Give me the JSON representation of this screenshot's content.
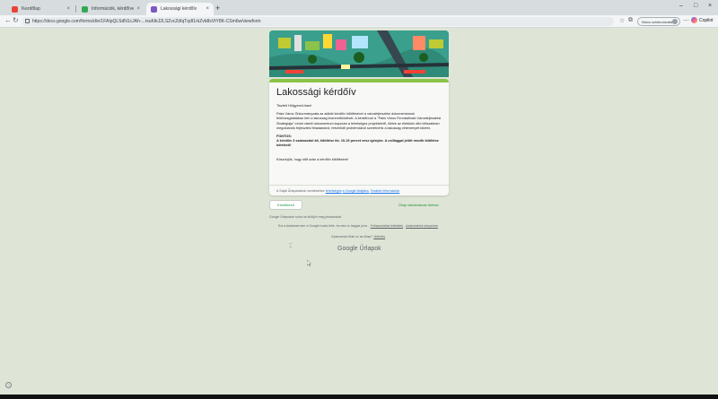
{
  "browser": {
    "tabs": [
      {
        "label": "Kezdőlap"
      },
      {
        "label": "Információk, kérdőívek leírásai"
      },
      {
        "label": "Lakossági kérdőív"
      }
    ],
    "address": "https://docs.google.com/forms/d/e/1FAIpQLSdN1cJAh-...rsuKtkJ2LSZvcZdIqTqdI1rkZvb8sVtY8K-CSm6w/viewform",
    "sync_label": "Nincs szinkronizálás",
    "copilot_label": "Copilot",
    "new_tab": "+"
  },
  "form": {
    "title": "Lakossági kérdőív",
    "greeting": "Tisztelt Hölgyem/Uram!",
    "intro": "Paks Város Önkormányzata az alábbi kérdőív kitöltésével a városfejlesztési dokumentumok felülvizsgálatában kéri a lakosság közreműködését. A kérdőívvel a \"Paks Város Fenntartható Városfejlesztési Stratégiája\" címet viselő dokumentum kapcsán a lehetséges projektekről, illetve az életükön álló időszakban megoldandó fejlesztési feladatokról, felvetődő problémákról szeretnénk a lakosság véleményét kikérni.",
    "important_label": "FONTOS:",
    "important_text": "A kérdőív 3 szakaszból áll, kitöltése kb. 10-15 percet vesz igénybe. A csillaggal jelölt mezők kitöltése kötelező!",
    "thanks": "Köszönjük, hogy időt szán a kérdőív kitöltésére!",
    "note_prefix": "A Saját Űrlapadatok mentéséhez",
    "note_link": "lehetséges",
    "note_middle": "a Google-fiókjába.",
    "note_more": "További információk",
    "next_button": "Következő",
    "clear_link": "Űrlap tartalmának törlése"
  },
  "footer": {
    "never_submit": "Google Űrlapokon soha ne küldjön meg jelszavakat.",
    "disclaimer_prefix": "Ezt a tartalmat nem a Google hozta létre, és nem is hagyta jóvá. -",
    "disclaimer_links": [
      "Felhasználási feltételek",
      "Adatvédelmi irányelvek"
    ],
    "report_prefix": "Gyanúsnak tűnik ez az űrlap?",
    "report_link": "Jelentés",
    "logo": "Google Űrlapok"
  },
  "colors": {
    "accent": "#8bc34a",
    "link_green": "#1e8e3e",
    "page_bg": "#dfe5d6"
  }
}
